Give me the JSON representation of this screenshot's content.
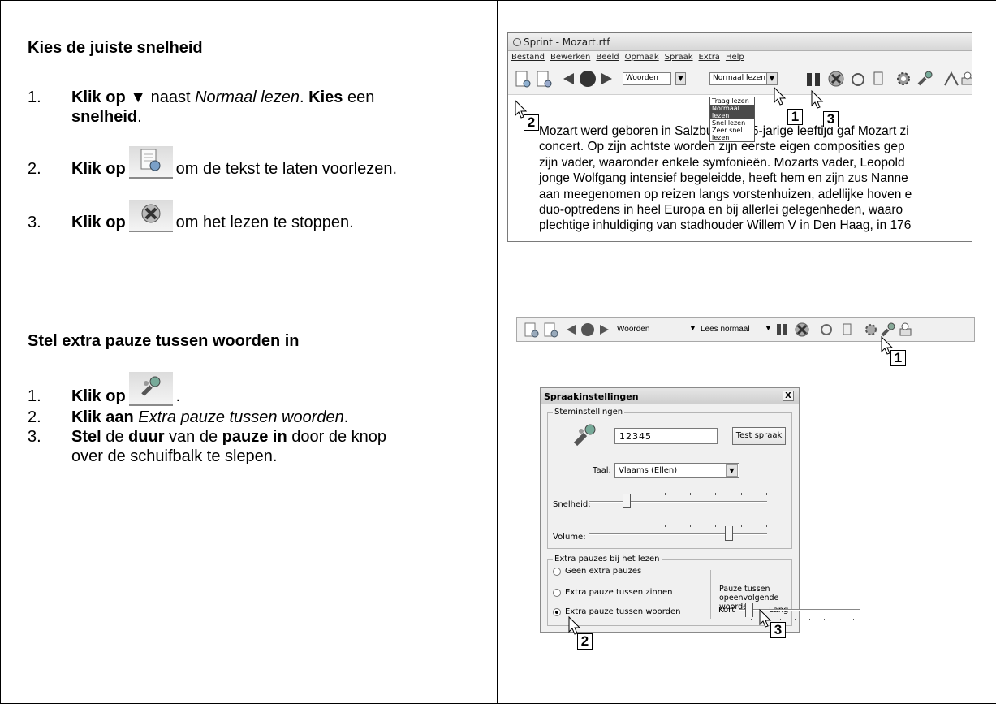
{
  "section1": {
    "heading": "Kies de juiste snelheid",
    "steps": [
      {
        "num": "1.",
        "b1": "Klik op ▼",
        "t1": " naast ",
        "i1": "Normaal lezen",
        "t2": ". ",
        "b2": "Kies",
        "t3": " een",
        "b3": "snelheid",
        "t4": "."
      },
      {
        "num": "2.",
        "b1": "Klik op",
        "t1": " om de tekst te laten voorlezen."
      },
      {
        "num": "3.",
        "b1": "Klik op",
        "t1": " om het lezen te stoppen."
      }
    ]
  },
  "section2": {
    "heading": "Stel extra pauze tussen woorden in",
    "steps": [
      {
        "num": "1.",
        "b1": "Klik op",
        "t1": " ."
      },
      {
        "num": "2.",
        "b1": "Klik aan",
        "i1": " Extra pauze tussen woorden",
        "t1": "."
      },
      {
        "num": "3.",
        "b1": "Stel",
        "t1": " de ",
        "b2": "duur",
        "t2": " van de ",
        "b3": "pauze in",
        "t3": " door de knop",
        "line2": "over de schuifbalk te slepen."
      }
    ]
  },
  "screenshot1": {
    "window_title": "Sprint - Mozart.rtf",
    "menu": [
      "Bestand",
      "Bewerken",
      "Beeld",
      "Opmaak",
      "Spraak",
      "Extra",
      "Help"
    ],
    "unit_select": "Woorden",
    "speed_select": "Normaal lezen",
    "speed_options": [
      "Traag lezen",
      "Normaal lezen",
      "Snel lezen",
      "Zeer snel lezen"
    ],
    "selected_speed": "Normaal lezen",
    "callouts": [
      "1",
      "2",
      "3"
    ],
    "document_lines": [
      "Mozart werd geboren in Salzburg. Op 5-jarige leeftijd gaf Mozart zi",
      "concert. Op zijn achtste worden zijn eerste eigen composities gep",
      "zijn vader, waaronder enkele symfonieën. Mozarts vader, Leopold",
      "jonge Wolfgang intensief begeleidde, heeft hem en zijn zus Nanne",
      "aan meegenomen op reizen langs vorstenhuizen, adellijke hoven e",
      "duo-optredens in heel Europa  en bij allerlei gelegenheden, waaro",
      "plechtige inhuldiging van stadhouder Willem V in Den Haag, in 176"
    ]
  },
  "screenshot2": {
    "unit_select": "Woorden",
    "speed_select": "Lees normaal",
    "callouts": [
      "1",
      "2",
      "3"
    ],
    "dialog": {
      "title": "Spraakinstellingen",
      "close": "X",
      "voice_group": "Steminstellingen",
      "test_text": "12345",
      "test_button": "Test spraak",
      "language_label": "Taal:",
      "language_value": "Vlaams (Ellen)",
      "speed_label": "Snelheid:",
      "speed_level": 0.2,
      "volume_label": "Volume:",
      "volume_level": 0.8,
      "pause_group": "Extra pauzes bij het lezen",
      "radio_options": [
        "Geen extra pauzes",
        "Extra pauze tussen zinnen",
        "Extra pauze tussen woorden"
      ],
      "selected_radio": 2,
      "pause_label": "Pauze tussen opeenvolgende woorden",
      "short_label": "Kort",
      "long_label": "Lang",
      "pause_level": 0.05
    }
  }
}
